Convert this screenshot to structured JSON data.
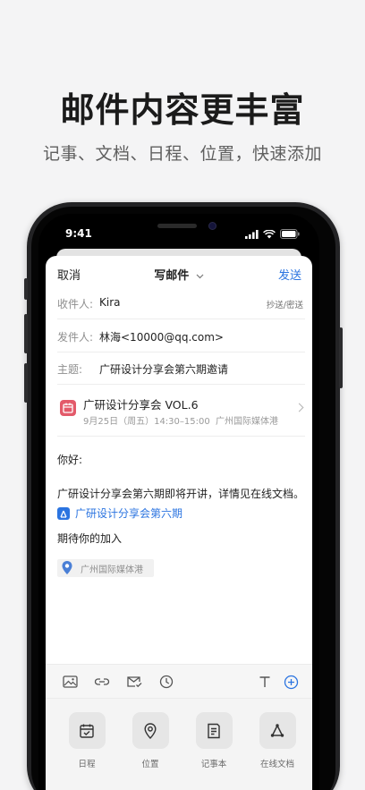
{
  "headline": "邮件内容更丰富",
  "subheadline": "记事、文档、日程、位置，快速添加",
  "status_bar": {
    "time": "9:41"
  },
  "compose": {
    "cancel_label": "取消",
    "title": "写邮件",
    "send_label": "发送",
    "to": {
      "label": "收件人:",
      "value": "Kira",
      "cc_bcc_label": "抄送/密送"
    },
    "from": {
      "label": "发件人:",
      "value": "林海<10000@qq.com>"
    },
    "subject": {
      "label": "主题:",
      "value": "广研设计分享会第六期邀请"
    },
    "event": {
      "title": "广研设计分享会 VOL.6",
      "time": "9月25日（周五）14:30–15:00",
      "location": "广州国际媒体港",
      "icon": "calendar-icon",
      "accent_color": "#e35a6a"
    },
    "body": {
      "greeting": "你好:",
      "paragraph": "广研设计分享会第六期即将开讲，详情见在线文档。",
      "doc_link": "广研设计分享会第六期",
      "closing": "期待你的加入",
      "location_chip": "广州国际媒体港"
    }
  },
  "toolbar": {
    "icons": [
      "image-icon",
      "link-icon",
      "mail-check-icon",
      "clock-icon",
      "text-format-icon",
      "add-circle-icon"
    ],
    "accent_color": "#2b74e0"
  },
  "tools": [
    {
      "label": "日程",
      "icon": "calendar-check-icon"
    },
    {
      "label": "位置",
      "icon": "location-pin-icon"
    },
    {
      "label": "记事本",
      "icon": "notebook-icon"
    },
    {
      "label": "在线文档",
      "icon": "online-doc-icon"
    }
  ]
}
